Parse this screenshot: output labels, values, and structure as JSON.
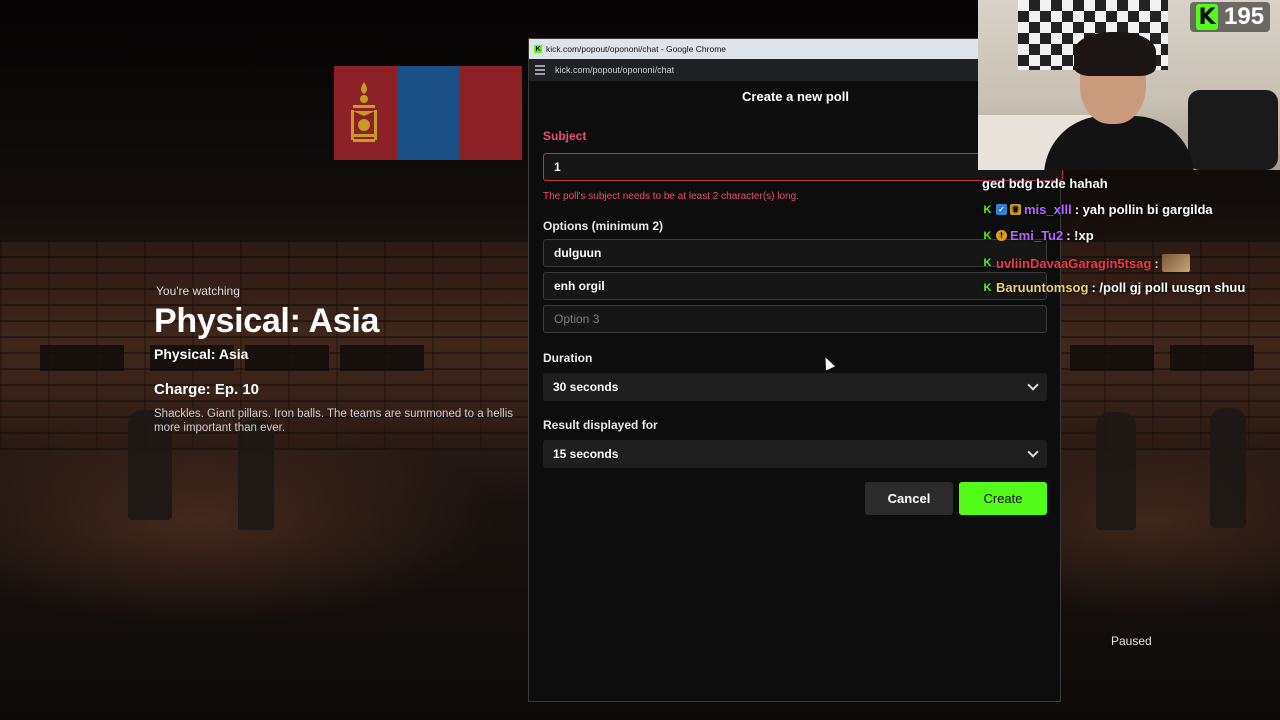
{
  "background": {
    "watching_label": "You're watching",
    "show_title": "Physical: Asia",
    "show_subtitle": "Physical: Asia",
    "episode_title": "Charge: Ep. 10",
    "synopsis_line1": "Shackles. Giant pillars. Iron balls. The teams are summoned to a hellis",
    "synopsis_line2": "more important than ever.",
    "paused_label": "Paused"
  },
  "popout": {
    "window_title": "kick.com/popout/opononi/chat - Google Chrome",
    "url": "kick.com/popout/opononi/chat",
    "poll": {
      "heading": "Create a new poll",
      "subject_label": "Subject",
      "subject_value": "1",
      "subject_error": "The poll's subject needs to be at least 2 character(s) long.",
      "options_label": "Options (minimum 2)",
      "options": [
        "dulguun",
        "enh orgil"
      ],
      "option3_placeholder": "Option 3",
      "duration_label": "Duration",
      "duration_value": "30 seconds",
      "result_label": "Result displayed for",
      "result_value": "15 seconds",
      "cancel_label": "Cancel",
      "create_label": "Create"
    },
    "colors": {
      "accent": "#53fc18",
      "error": "#ec4d74"
    }
  },
  "overlay": {
    "viewer_count": "195",
    "chat": [
      {
        "user": "",
        "message": "ged bdg bzde hahah"
      },
      {
        "user": "mis_xlll",
        "message": ": yah pollin bi gargilda"
      },
      {
        "user": "Emi_Tu2",
        "message": ": !xp"
      },
      {
        "user": "uvliinDavaaGaragin5tsag",
        "message": ":"
      },
      {
        "user": "Baruuntomsog",
        "message": ": /poll gj poll uusgn shuu"
      }
    ]
  }
}
